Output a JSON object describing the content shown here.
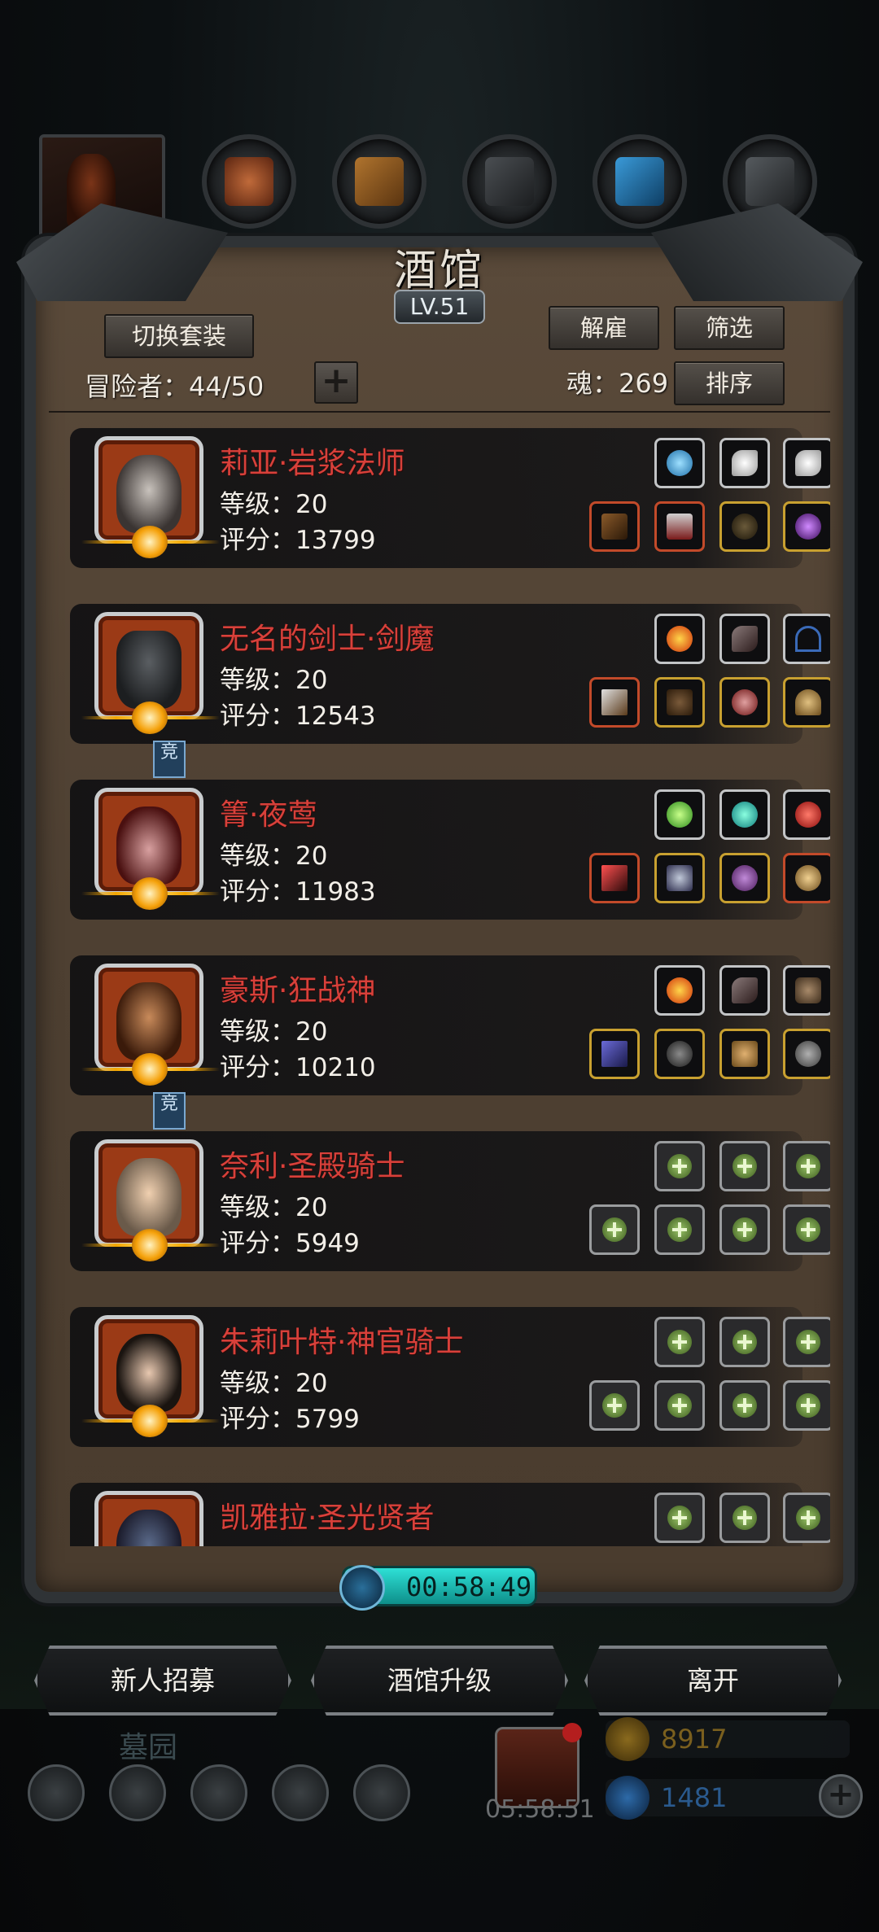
{
  "title": "酒馆",
  "level": "LV.51",
  "buttons": {
    "switch_outfit": "切换套装",
    "dismiss": "解雇",
    "filter": "筛选",
    "sort": "排序",
    "add_slot": "+"
  },
  "header": {
    "adventurers": "冒险者：44/50",
    "soul": "魂：269"
  },
  "compete_tag": "竞",
  "heroes": [
    {
      "name": "莉亚·岩浆法师",
      "level": "等级：20",
      "score": "评分：13799"
    },
    {
      "name": "无名的剑士·剑魔",
      "level": "等级：20",
      "score": "评分：12543"
    },
    {
      "name": "箐·夜莺",
      "level": "等级：20",
      "score": "评分：11983"
    },
    {
      "name": "豪斯·狂战神",
      "level": "等级：20",
      "score": "评分：10210"
    },
    {
      "name": "奈利·圣殿骑士",
      "level": "等级：20",
      "score": "评分：5949"
    },
    {
      "name": "朱莉叶特·神官骑士",
      "level": "等级：20",
      "score": "评分：5799"
    },
    {
      "name": "凯雅拉·圣光贤者",
      "level": "",
      "score": ""
    }
  ],
  "timer": "00:58:49",
  "bottom_buttons": {
    "recruit": "新人招募",
    "upgrade": "酒馆升级",
    "leave": "离开"
  },
  "footer": {
    "zone": "墓园",
    "gift_timer": "05:58:51",
    "gold": "8917",
    "gems": "1481",
    "add": "+"
  },
  "colors": {
    "hero_name": "#d8403a",
    "timer_accent": "#2ee0d6",
    "gold": "#8a6a1e",
    "gems": "#2d6aa8"
  }
}
